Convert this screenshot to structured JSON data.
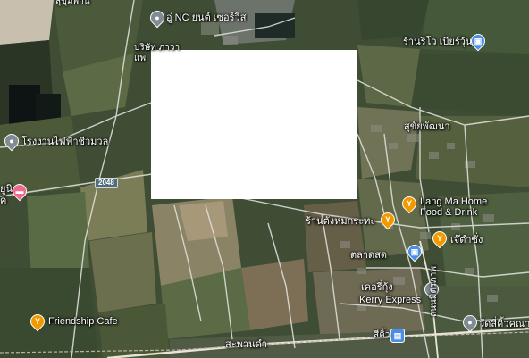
{
  "map": {
    "type": "satellite-hybrid",
    "colors": {
      "field_dark": "#2f3d2b",
      "field_light": "#8c8a6b",
      "water": "#1f2a2a",
      "road": "#d9dcd6",
      "overlay": "#ffffff"
    }
  },
  "places": {
    "top_cut": "สุขุมพาน",
    "nc_service": "อู่ NC ยนต์ เซอร์วิส",
    "company_1": "บริษัท ภาวา",
    "company_2": "แพ",
    "power_plant": "โรงงานไฟฟ้าชีวมวล",
    "hotel_cut_1": "ยูนิ",
    "hotel_cut_2": "ค",
    "supermarket": "ร้านริโว เบียร์วุ้น",
    "district": "สุขัยพัฒนา",
    "langma_1": "Lang Ma Home",
    "langma_2": "Food & Drink",
    "shop_nong": "ร้านตังหมกระทะ",
    "jay_shop": "เจ๊ตำซั่ง",
    "market": "ตลาดสด",
    "kerry_th": "เคอรี่กุ้ง",
    "kerry_en": "Kerry Express",
    "wat": "วัดสี่คิ้วคณาร",
    "friendship": "Friendship Cafe",
    "station_area": "สะพานดำ",
    "si_khiu": "สีคิ้ว",
    "road_side": "ถนนมิตรภาพ"
  },
  "road_shields": {
    "route_2048": "2048"
  },
  "icons": [
    "pin-grey-icon",
    "pin-orange-food-icon",
    "pin-blue-shop-icon",
    "pin-pink-hotel-icon",
    "train-icon"
  ]
}
